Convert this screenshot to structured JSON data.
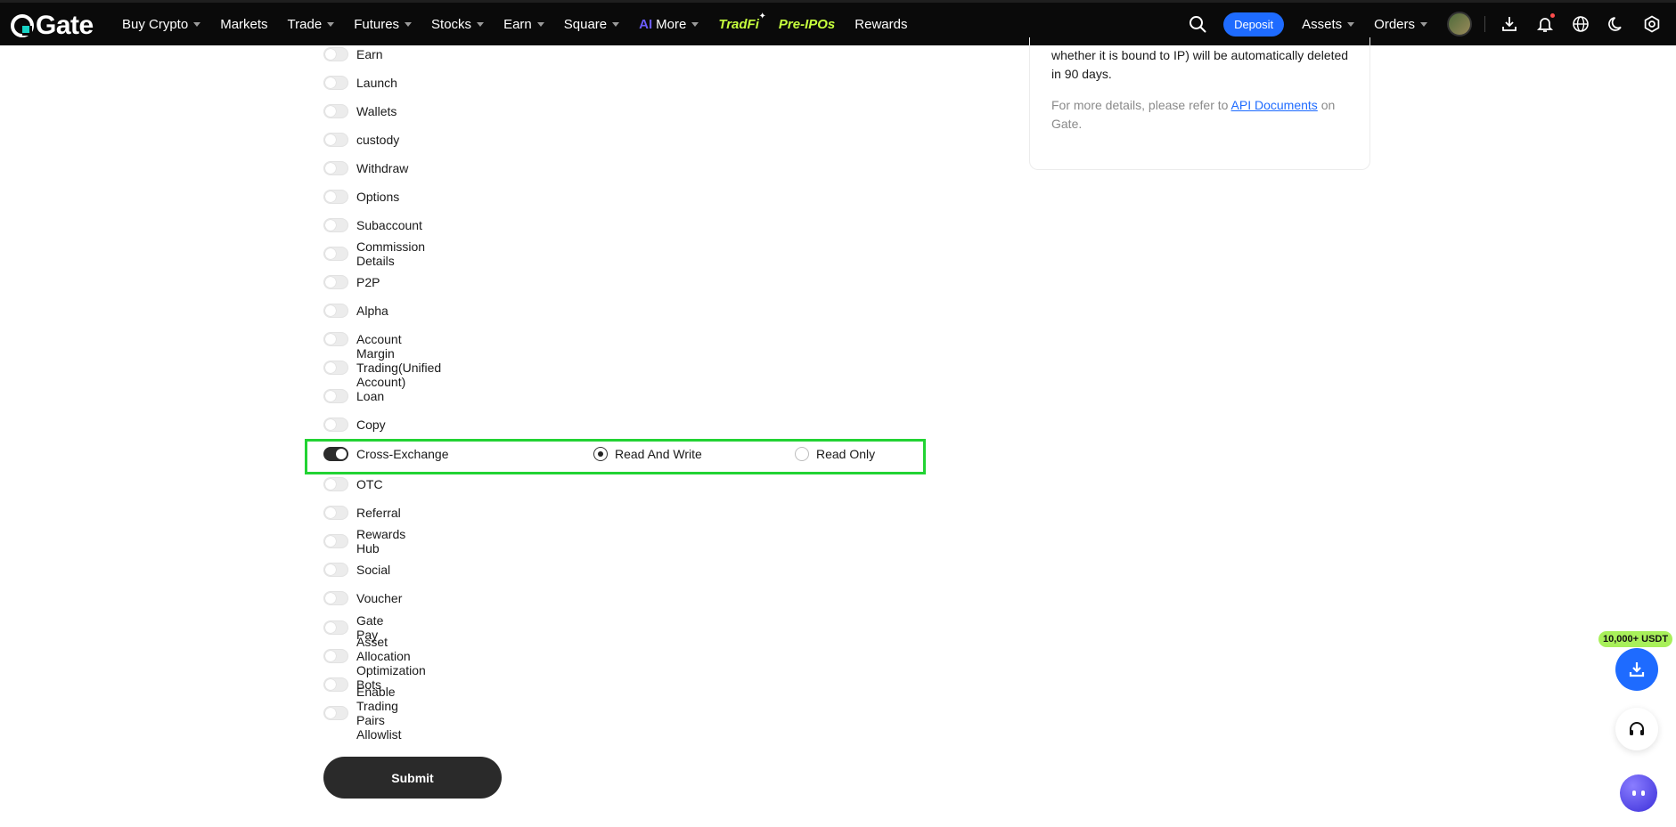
{
  "brand": {
    "name": "Gate"
  },
  "nav": {
    "items": [
      {
        "label": "Buy Crypto",
        "caret": true
      },
      {
        "label": "Markets",
        "caret": false
      },
      {
        "label": "Trade",
        "caret": true
      },
      {
        "label": "Futures",
        "caret": true
      },
      {
        "label": "Stocks",
        "caret": true
      },
      {
        "label": "Earn",
        "caret": true
      },
      {
        "label": "Square",
        "caret": true
      },
      {
        "label": "More",
        "caret": true
      }
    ],
    "more_badge": "AI",
    "tradfi": "TradFi",
    "preipo": "Pre-IPOs",
    "rewards": "Rewards"
  },
  "right_nav": {
    "deposit_label": "Deposit",
    "assets_label": "Assets",
    "orders_label": "Orders"
  },
  "permissions": [
    {
      "label": "Earn",
      "enabled": false
    },
    {
      "label": "Launch",
      "enabled": false
    },
    {
      "label": "Wallets",
      "enabled": false
    },
    {
      "label": "custody",
      "enabled": false
    },
    {
      "label": "Withdraw",
      "enabled": false
    },
    {
      "label": "Options",
      "enabled": false
    },
    {
      "label": "Subaccount",
      "enabled": false
    },
    {
      "label": "Commission Details",
      "enabled": false
    },
    {
      "label": "P2P",
      "enabled": false
    },
    {
      "label": "Alpha",
      "enabled": false
    },
    {
      "label": "Account",
      "enabled": false
    },
    {
      "label": "Margin Trading(Unified Account)",
      "enabled": false
    },
    {
      "label": "Loan",
      "enabled": false
    },
    {
      "label": "Copy",
      "enabled": false
    },
    {
      "label": "Cross-Exchange",
      "enabled": true
    },
    {
      "label": "OTC",
      "enabled": false
    },
    {
      "label": "Referral",
      "enabled": false
    },
    {
      "label": "Rewards Hub",
      "enabled": false
    },
    {
      "label": "Social",
      "enabled": false
    },
    {
      "label": "Voucher",
      "enabled": false
    },
    {
      "label": "Gate Pay",
      "enabled": false
    },
    {
      "label": "Asset Allocation Optimization",
      "enabled": false
    },
    {
      "label": "Bots",
      "enabled": false
    },
    {
      "label": "Enable Trading Pairs Allowlist",
      "enabled": false
    }
  ],
  "access_options": {
    "read_write": "Read And Write",
    "read_only": "Read Only",
    "selected": "read_write"
  },
  "submit_label": "Submit",
  "info": {
    "strong_text": "whether it is bound to IP) will be automatically deleted in 90 days.",
    "muted_prefix": "For more details, please refer to ",
    "link_text": "API Documents",
    "muted_suffix": " on Gate."
  },
  "promo_badge": "10,000+ USDT",
  "colors": {
    "accent_blue": "#1e6bff",
    "highlight_green": "#22d333",
    "promo_green": "#a8f05a"
  }
}
